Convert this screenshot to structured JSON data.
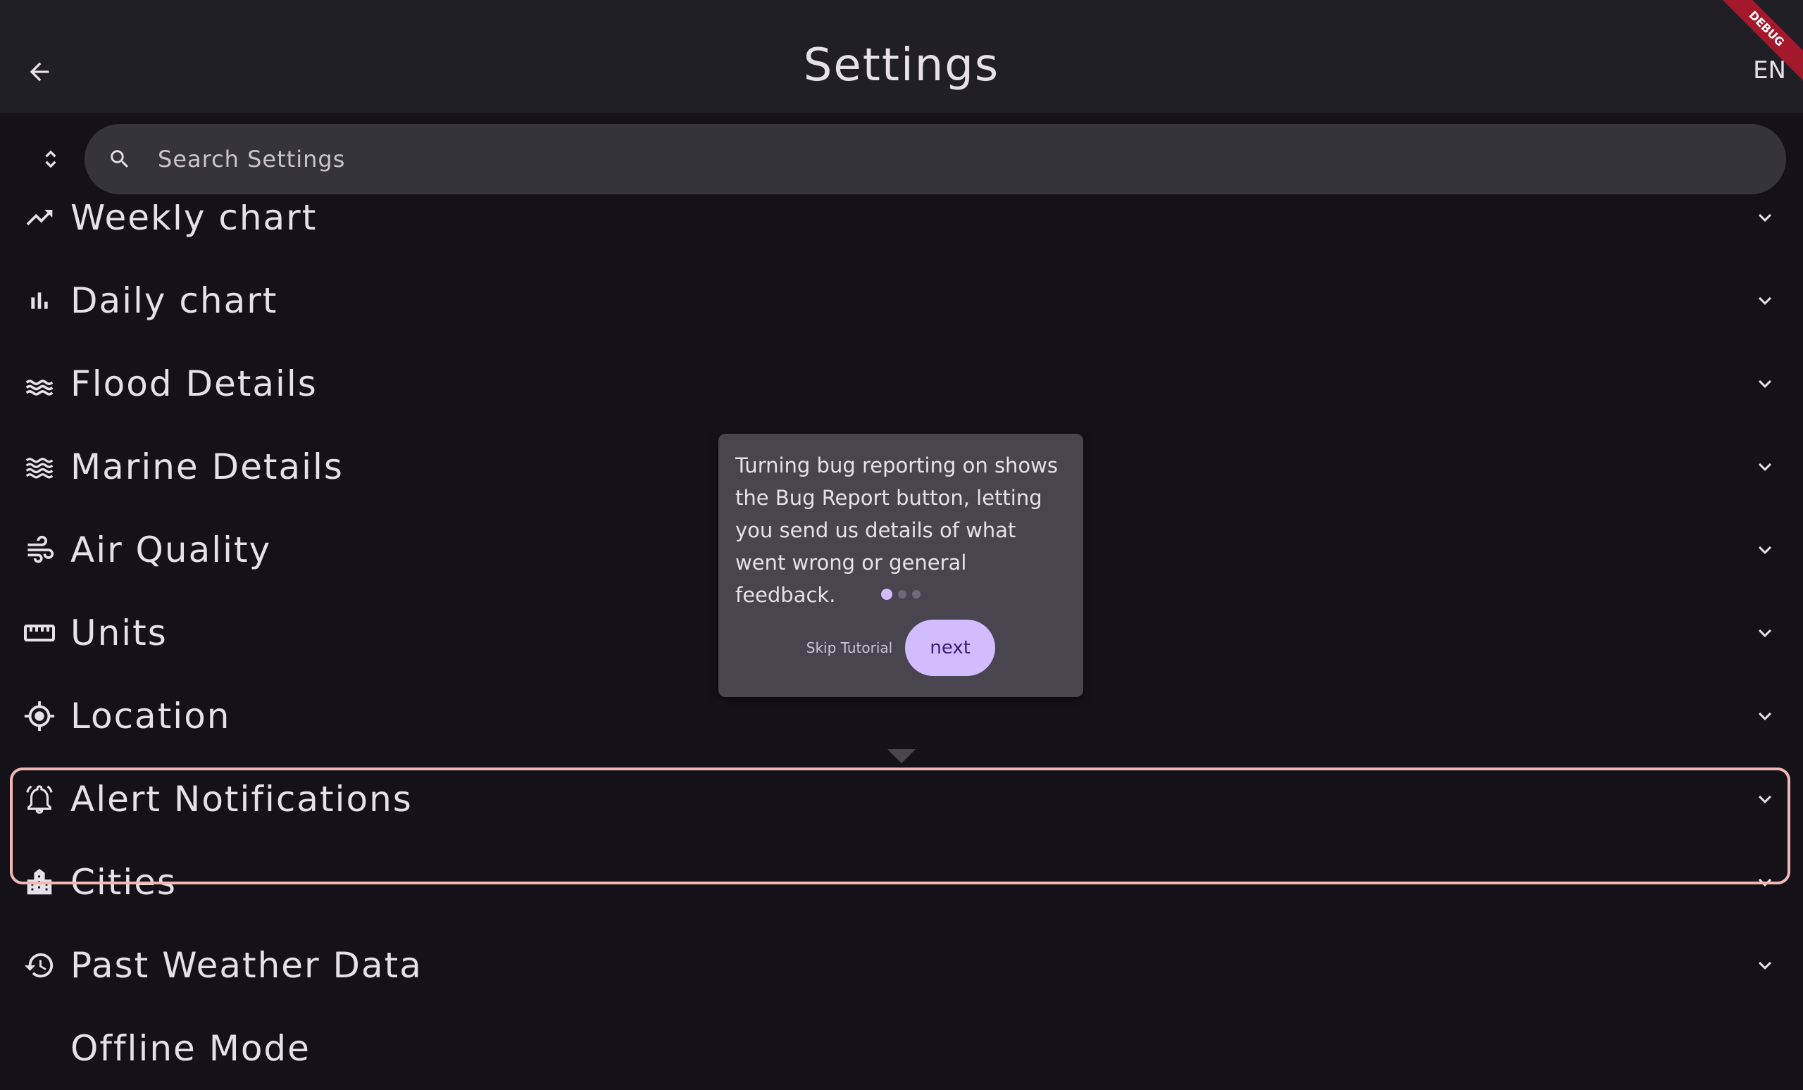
{
  "appbar": {
    "title": "Settings",
    "language": "EN",
    "debug_banner": "DEBUG"
  },
  "search": {
    "placeholder": "Search Settings"
  },
  "settings_items": [
    {
      "label": "Weekly chart",
      "icon": "trending-up-icon"
    },
    {
      "label": "Daily chart",
      "icon": "bar-chart-icon"
    },
    {
      "label": "Flood Details",
      "icon": "flood-waves-icon"
    },
    {
      "label": "Marine Details",
      "icon": "marine-waves-icon"
    },
    {
      "label": "Air Quality",
      "icon": "air-wind-icon"
    },
    {
      "label": "Units",
      "icon": "ruler-icon"
    },
    {
      "label": "Location",
      "icon": "gps-fixed-icon"
    },
    {
      "label": "Alert Notifications",
      "icon": "alarm-bell-icon"
    },
    {
      "label": "Cities",
      "icon": "city-building-icon"
    },
    {
      "label": "Past Weather Data",
      "icon": "history-icon"
    },
    {
      "label": "Offline Mode",
      "icon": "offline-icon"
    }
  ],
  "tutorial": {
    "text": "Turning bug reporting on shows the Bug Report button, letting you send us details of what went wrong or general feedback.",
    "skip_label": "Skip Tutorial",
    "next_label": "next",
    "step_current": 1,
    "step_total": 3
  },
  "colors": {
    "background": "#141218",
    "appbar": "#211f26",
    "accent": "#d0bcff",
    "highlight_border": "#f2b8b5",
    "tooltip_bg": "#49454f"
  }
}
